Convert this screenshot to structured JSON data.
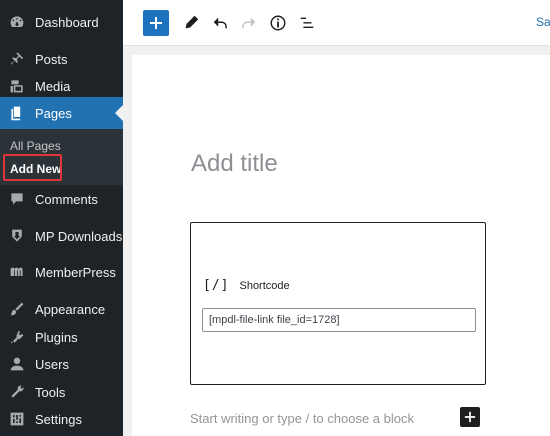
{
  "sidebar": {
    "items": [
      {
        "label": "Dashboard",
        "icon": "dashboard-icon"
      },
      {
        "label": "Posts",
        "icon": "pin-icon"
      },
      {
        "label": "Media",
        "icon": "media-icon"
      },
      {
        "label": "Pages",
        "icon": "pages-icon",
        "active": true
      },
      {
        "label": "Comments",
        "icon": "comment-icon"
      },
      {
        "label": "MP Downloads",
        "icon": "download-icon"
      },
      {
        "label": "MemberPress",
        "icon": "memberpress-icon"
      },
      {
        "label": "Appearance",
        "icon": "brush-icon"
      },
      {
        "label": "Plugins",
        "icon": "plugin-icon"
      },
      {
        "label": "Users",
        "icon": "user-icon"
      },
      {
        "label": "Tools",
        "icon": "wrench-icon"
      },
      {
        "label": "Settings",
        "icon": "settings-icon"
      }
    ],
    "submenu": {
      "all_pages": "All Pages",
      "add_new": "Add New"
    },
    "active_color": "#2271b1",
    "highlight_color": "#e0353b"
  },
  "toolbar": {
    "save_label": "Save draft"
  },
  "editor": {
    "title_placeholder": "Add title",
    "block": {
      "icon_glyph": "[/]",
      "label": "Shortcode",
      "value": "[mpdl-file-link file_id=1728]"
    },
    "body_placeholder": "Start writing or type / to choose a block"
  }
}
